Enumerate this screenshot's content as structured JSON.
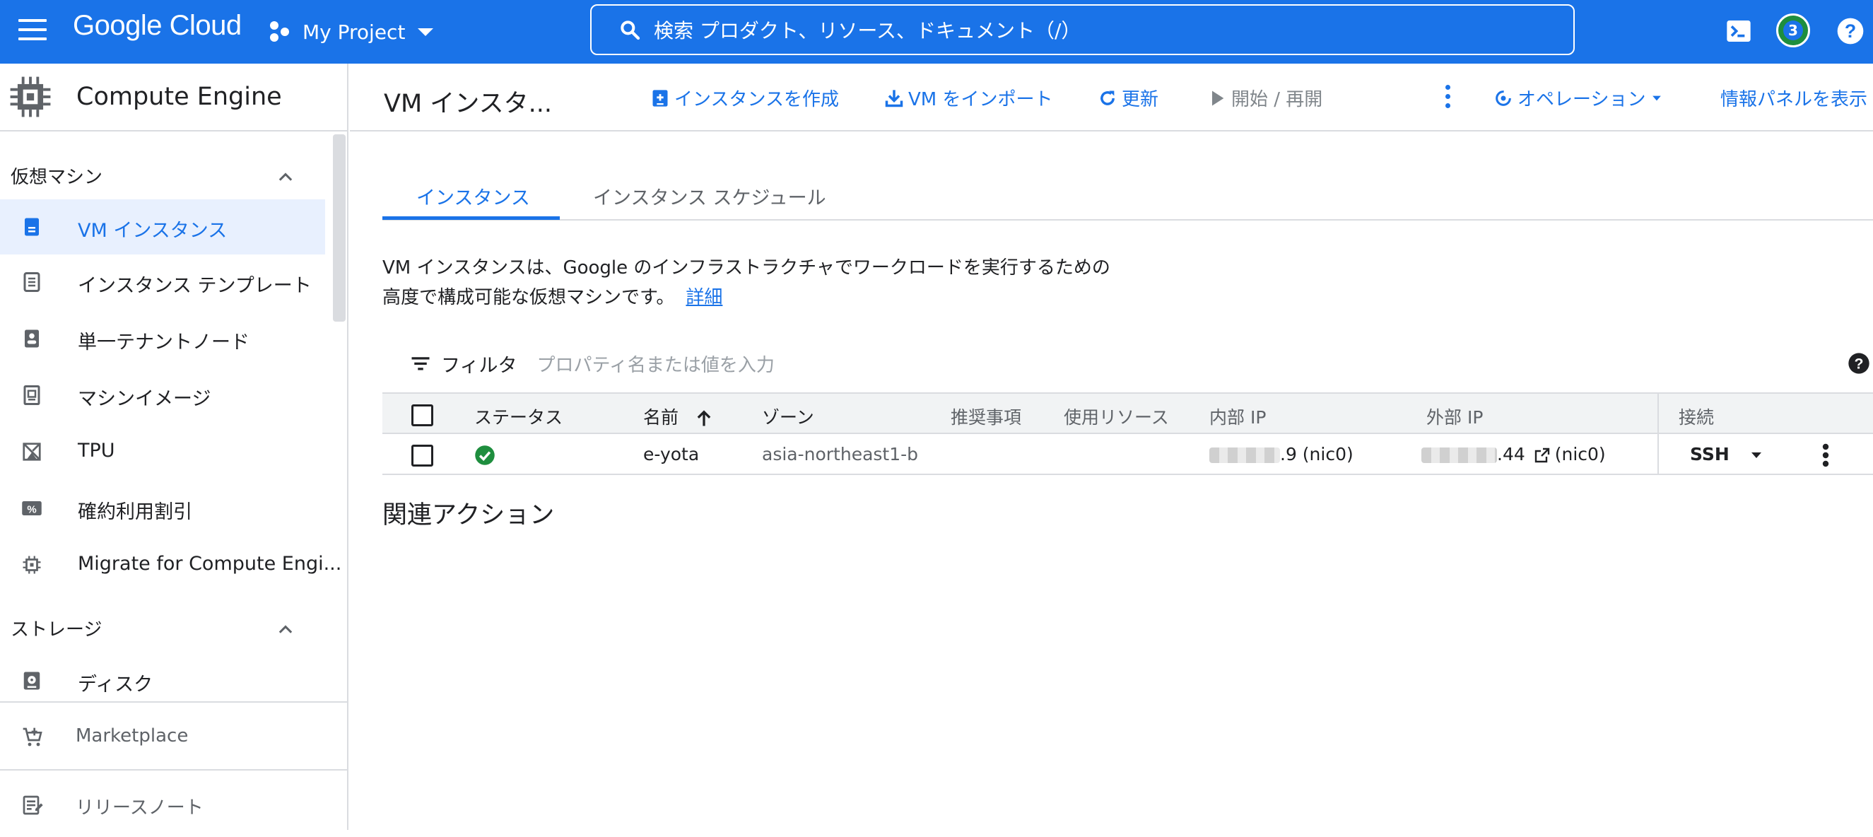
{
  "topbar": {
    "logo": "Google Cloud",
    "project": "My Project",
    "search_placeholder": "検索  プロダクト、リソース、ドキュメント（/）",
    "notification_count": "3"
  },
  "sidebar": {
    "product": "Compute Engine",
    "sections": [
      {
        "label": "仮想マシン",
        "items": [
          {
            "label": "VM インスタンス",
            "icon": "vm-instance-icon",
            "active": true
          },
          {
            "label": "インスタンス テンプレート",
            "icon": "template-icon"
          },
          {
            "label": "単一テナントノード",
            "icon": "sole-tenant-icon"
          },
          {
            "label": "マシンイメージ",
            "icon": "machine-image-icon"
          },
          {
            "label": "TPU",
            "icon": "tpu-icon"
          },
          {
            "label": "確約利用割引",
            "icon": "percent-icon"
          },
          {
            "label": "Migrate for Compute Engi...",
            "icon": "migrate-icon"
          }
        ]
      },
      {
        "label": "ストレージ",
        "items": [
          {
            "label": "ディスク",
            "icon": "disk-icon"
          }
        ]
      }
    ],
    "footer": [
      {
        "label": "Marketplace",
        "icon": "cart-icon"
      },
      {
        "label": "リリースノート",
        "icon": "notes-icon"
      }
    ]
  },
  "header": {
    "title": "VM インスタ...",
    "actions": {
      "create": "インスタンスを作成",
      "import": "VM をインポート",
      "refresh": "更新",
      "start": "開始 / 再開",
      "operations": "オペレーション",
      "info_panel": "情報パネルを表示"
    }
  },
  "tabs": [
    "インスタンス",
    "インスタンス スケジュール"
  ],
  "description": {
    "line1": "VM インスタンスは、Google のインフラストラクチャでワークロードを実行するための",
    "line2": "高度で構成可能な仮想マシンです。",
    "link": "詳細"
  },
  "filter": {
    "label": "フィルタ",
    "placeholder": "プロパティ名または値を入力"
  },
  "table": {
    "columns": {
      "status": "ステータス",
      "name": "名前",
      "zone": "ゾーン",
      "recommendation": "推奨事項",
      "used_resources": "使用リソース",
      "internal_ip": "内部 IP",
      "external_ip": "外部 IP",
      "connect": "接続"
    },
    "rows": [
      {
        "status": "running",
        "name": "e-yota",
        "zone": "asia-northeast1-b",
        "internal_ip_suffix": ".9 (nic0)",
        "external_ip_suffix": ".44",
        "external_ip_nic": "(nic0)",
        "connect": "SSH"
      }
    ]
  },
  "related_actions": "関連アクション",
  "colors": {
    "brand": "#1a73e8",
    "status_ok": "#1e8e3e"
  }
}
